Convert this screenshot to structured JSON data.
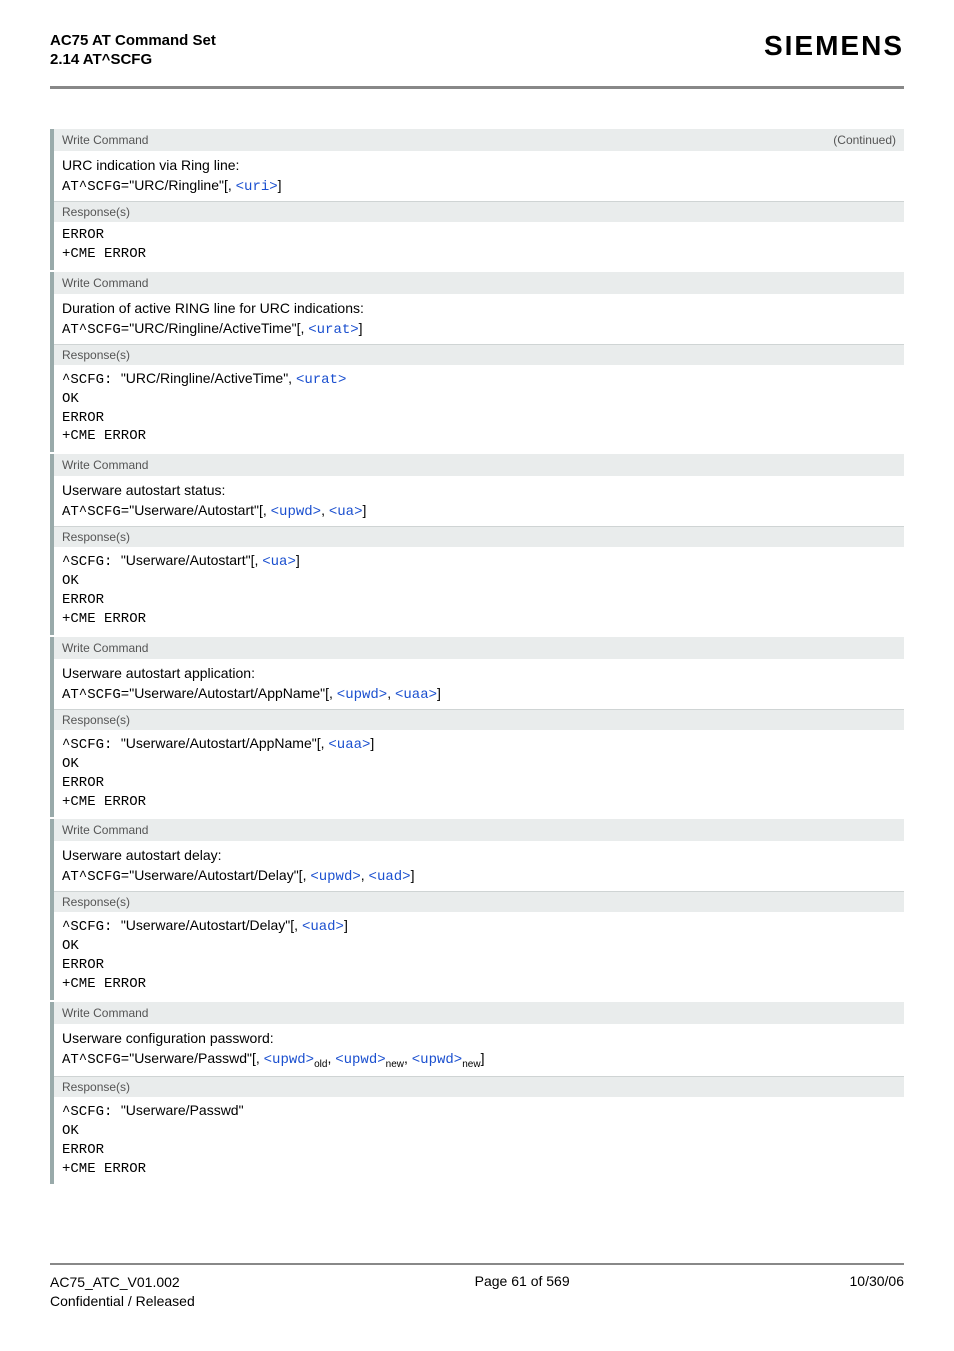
{
  "header": {
    "title": "AC75 AT Command Set",
    "subtitle": "2.14 AT^SCFG",
    "logo": "SIEMENS"
  },
  "labels": {
    "write_command": "Write Command",
    "responses": "Response(s)",
    "continued": "(Continued)"
  },
  "common": {
    "at_prefix": "AT^SCFG=",
    "scfg_prefix": "^SCFG: ",
    "ok": "OK",
    "error": "ERROR",
    "cme_error": "+CME ERROR"
  },
  "sections": [
    {
      "id": "ringline",
      "desc": "URC indication via Ring line:",
      "cmd_value": "\"URC/Ringline\"",
      "cmd_params": [
        "<uri>"
      ],
      "resp_prefix": false,
      "resp_value": "",
      "resp_params": []
    },
    {
      "id": "ringline-active",
      "desc": "Duration of active RING line for URC indications:",
      "cmd_value": "\"URC/Ringline/ActiveTime\"",
      "cmd_params": [
        "<urat>"
      ],
      "resp_prefix": true,
      "resp_value": "\"URC/Ringline/ActiveTime\", ",
      "resp_params": [
        "<urat>"
      ],
      "resp_trailing": ""
    },
    {
      "id": "autostart",
      "desc": "Userware autostart status:",
      "cmd_value": "\"Userware/Autostart\"",
      "cmd_params": [
        "<upwd>",
        "<ua>"
      ],
      "resp_prefix": true,
      "resp_value": "\"Userware/Autostart\"",
      "resp_bracket": true,
      "resp_params": [
        "<ua>"
      ]
    },
    {
      "id": "autostart-app",
      "desc": "Userware autostart application:",
      "cmd_value": "\"Userware/Autostart/AppName\"",
      "cmd_params": [
        "<upwd>",
        "<uaa>"
      ],
      "resp_prefix": true,
      "resp_value": "\"Userware/Autostart/AppName\"",
      "resp_bracket": true,
      "resp_params": [
        "<uaa>"
      ]
    },
    {
      "id": "autostart-delay",
      "desc": "Userware autostart delay:",
      "cmd_value": "\"Userware/Autostart/Delay\"",
      "cmd_params": [
        "<upwd>",
        "<uad>"
      ],
      "resp_prefix": true,
      "resp_value": "\"Userware/Autostart/Delay\"",
      "resp_bracket": true,
      "resp_params": [
        "<uad>"
      ]
    },
    {
      "id": "passwd",
      "desc": "Userware configuration password:",
      "cmd_value": "\"Userware/Passwd\"",
      "cmd_params_sub": [
        {
          "p": "<upwd>",
          "s": "old"
        },
        {
          "p": "<upwd>",
          "s": "new"
        },
        {
          "p": "<upwd>",
          "s": "new"
        }
      ],
      "resp_prefix": true,
      "resp_value": "\"Userware/Passwd\"",
      "resp_params": []
    }
  ],
  "footer": {
    "left1": "AC75_ATC_V01.002",
    "left2": "Confidential / Released",
    "center": "Page 61 of 569",
    "right": "10/30/06"
  }
}
